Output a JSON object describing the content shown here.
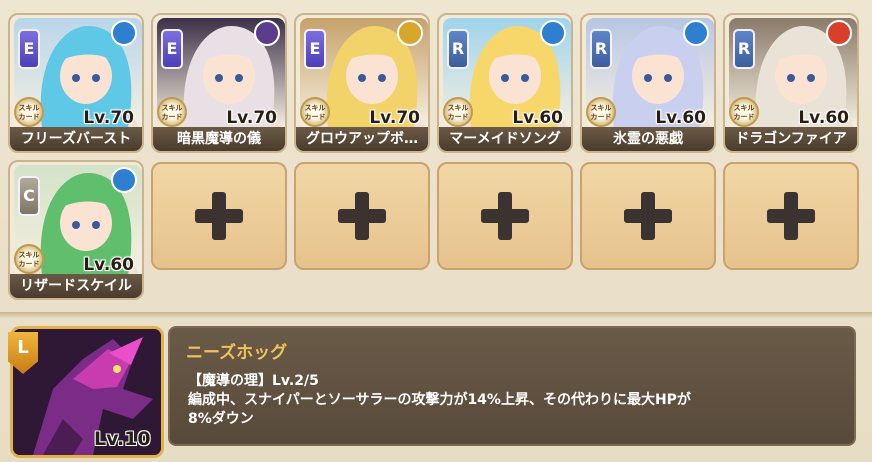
{
  "party": [
    {
      "rank": "E",
      "element": "water",
      "name": "フリーズバースト",
      "level": "Lv.70",
      "skill_card": "スキルカード",
      "hair": "#5ec8e6",
      "bg": "#b9d6ea"
    },
    {
      "rank": "E",
      "element": "dark",
      "name": "暗黒魔導の儀",
      "level": "Lv.70",
      "skill_card": "スキルカード",
      "hair": "#e8e0e4",
      "bg": "#3c3048"
    },
    {
      "rank": "E",
      "element": "light",
      "name": "グロウアップボ…",
      "level": "Lv.70",
      "skill_card": "スキルカード",
      "hair": "#f2d36a",
      "bg": "#c6a26a"
    },
    {
      "rank": "R",
      "element": "water",
      "name": "マーメイドソング",
      "level": "Lv.60",
      "skill_card": "スキルカード",
      "hair": "#f7d66a",
      "bg": "#9fd4ec"
    },
    {
      "rank": "R",
      "element": "water",
      "name": "氷霊の悪戯",
      "level": "Lv.60",
      "skill_card": "スキルカード",
      "hair": "#c9cfee",
      "bg": "#b8c6e4"
    },
    {
      "rank": "R",
      "element": "fire",
      "name": "ドラゴンファイア",
      "level": "Lv.60",
      "skill_card": "スキルカード",
      "hair": "#e9e2d6",
      "bg": "#8a7a6a"
    },
    {
      "rank": "C",
      "element": "water",
      "name": "リザードスケイル",
      "level": "Lv.60",
      "skill_card": "スキルカード",
      "hair": "#5fbf6c",
      "bg": "#d3e2c8"
    }
  ],
  "empty_slots": 5,
  "leader": {
    "rank": "L",
    "level": "Lv.10",
    "name": "ニーズホッグ",
    "skill_line": "【魔導の理】Lv.2/5",
    "desc_line1": "編成中、スナイパーとソーサラーの攻撃力が14%上昇、その代わりに最大HPが",
    "desc_line2": "8%ダウン"
  },
  "colors": {
    "water": "#2f7fd0",
    "dark": "#5b3c8a",
    "light": "#d8a62a",
    "fire": "#d8402c",
    "title": "#f3c35a"
  }
}
